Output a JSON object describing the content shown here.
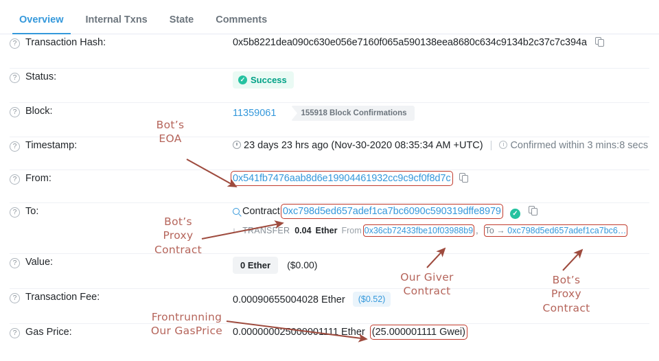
{
  "tabs": [
    {
      "label": "Overview",
      "active": true
    },
    {
      "label": "Internal Txns",
      "active": false
    },
    {
      "label": "State",
      "active": false
    },
    {
      "label": "Comments",
      "active": false
    }
  ],
  "rows": {
    "hash": {
      "label": "Transaction Hash:",
      "value": "0x5b8221dea090c630e056e7160f065a590138eea8680c634c9134b2c37c7c394a",
      "copy_icon": "copy-icon"
    },
    "status": {
      "label": "Status:",
      "badge": "Success",
      "badge_icon": "check-circle-icon"
    },
    "block": {
      "label": "Block:",
      "number": "11359061",
      "confirmations": "155918 Block Confirmations"
    },
    "timestamp": {
      "label": "Timestamp:",
      "clock_icon": "clock-icon",
      "ago": "23 days 23 hrs ago (Nov-30-2020 08:35:34 AM +UTC)",
      "separator": "|",
      "info_icon": "info-circle-icon",
      "confirmed": "Confirmed within 3 mins:8 secs"
    },
    "from": {
      "label": "From:",
      "address": "0x541fb7476aab8d6e19904461932cc9c9cf0f8d7c",
      "copy_icon": "copy-icon"
    },
    "to": {
      "label": "To:",
      "search_icon": "magnifier-icon",
      "contract_word": "Contract",
      "address": "0xc798d5ed657adef1ca7bc6090c590319dffe8979",
      "verified_icon": "check-circle-icon",
      "copy_icon": "copy-icon",
      "transfer": {
        "tree": "└",
        "label": "TRANSFER",
        "amount": "0.04",
        "unit": "Ether",
        "from_word": "From",
        "from_address": "0x36cb72433fbe10f03988b9",
        "comma": ",",
        "to_word": "To →",
        "to_address": "0xc798d5ed657adef1ca7bc6…"
      }
    },
    "value": {
      "label": "Value:",
      "amount": "0 Ether",
      "usd": "($0.00)"
    },
    "fee": {
      "label": "Transaction Fee:",
      "amount": "0.00090655004028 Ether",
      "usd": "($0.52)"
    },
    "gas_price": {
      "label": "Gas Price:",
      "amount": "0.000000025000001111 Ether",
      "gwei": "(25.000001111 Gwei)"
    }
  },
  "annotations": [
    {
      "id": "bots-eoa",
      "text": "Bot’s\nEOA"
    },
    {
      "id": "bots-proxy-contract-left",
      "text": "Bot’s\nProxy\nContract"
    },
    {
      "id": "our-giver-contract",
      "text": "Our Giver\nContract"
    },
    {
      "id": "bots-proxy-contract-right",
      "text": "Bot’s\nProxy\nContract"
    },
    {
      "id": "frontrunning-our-gasprice",
      "text": "Frontrunning\nOur GasPrice"
    }
  ],
  "colors": {
    "accent_blue": "#3498db",
    "success_green": "#00a186",
    "annotation_red": "#b5645a",
    "box_red": "#c0392b"
  }
}
